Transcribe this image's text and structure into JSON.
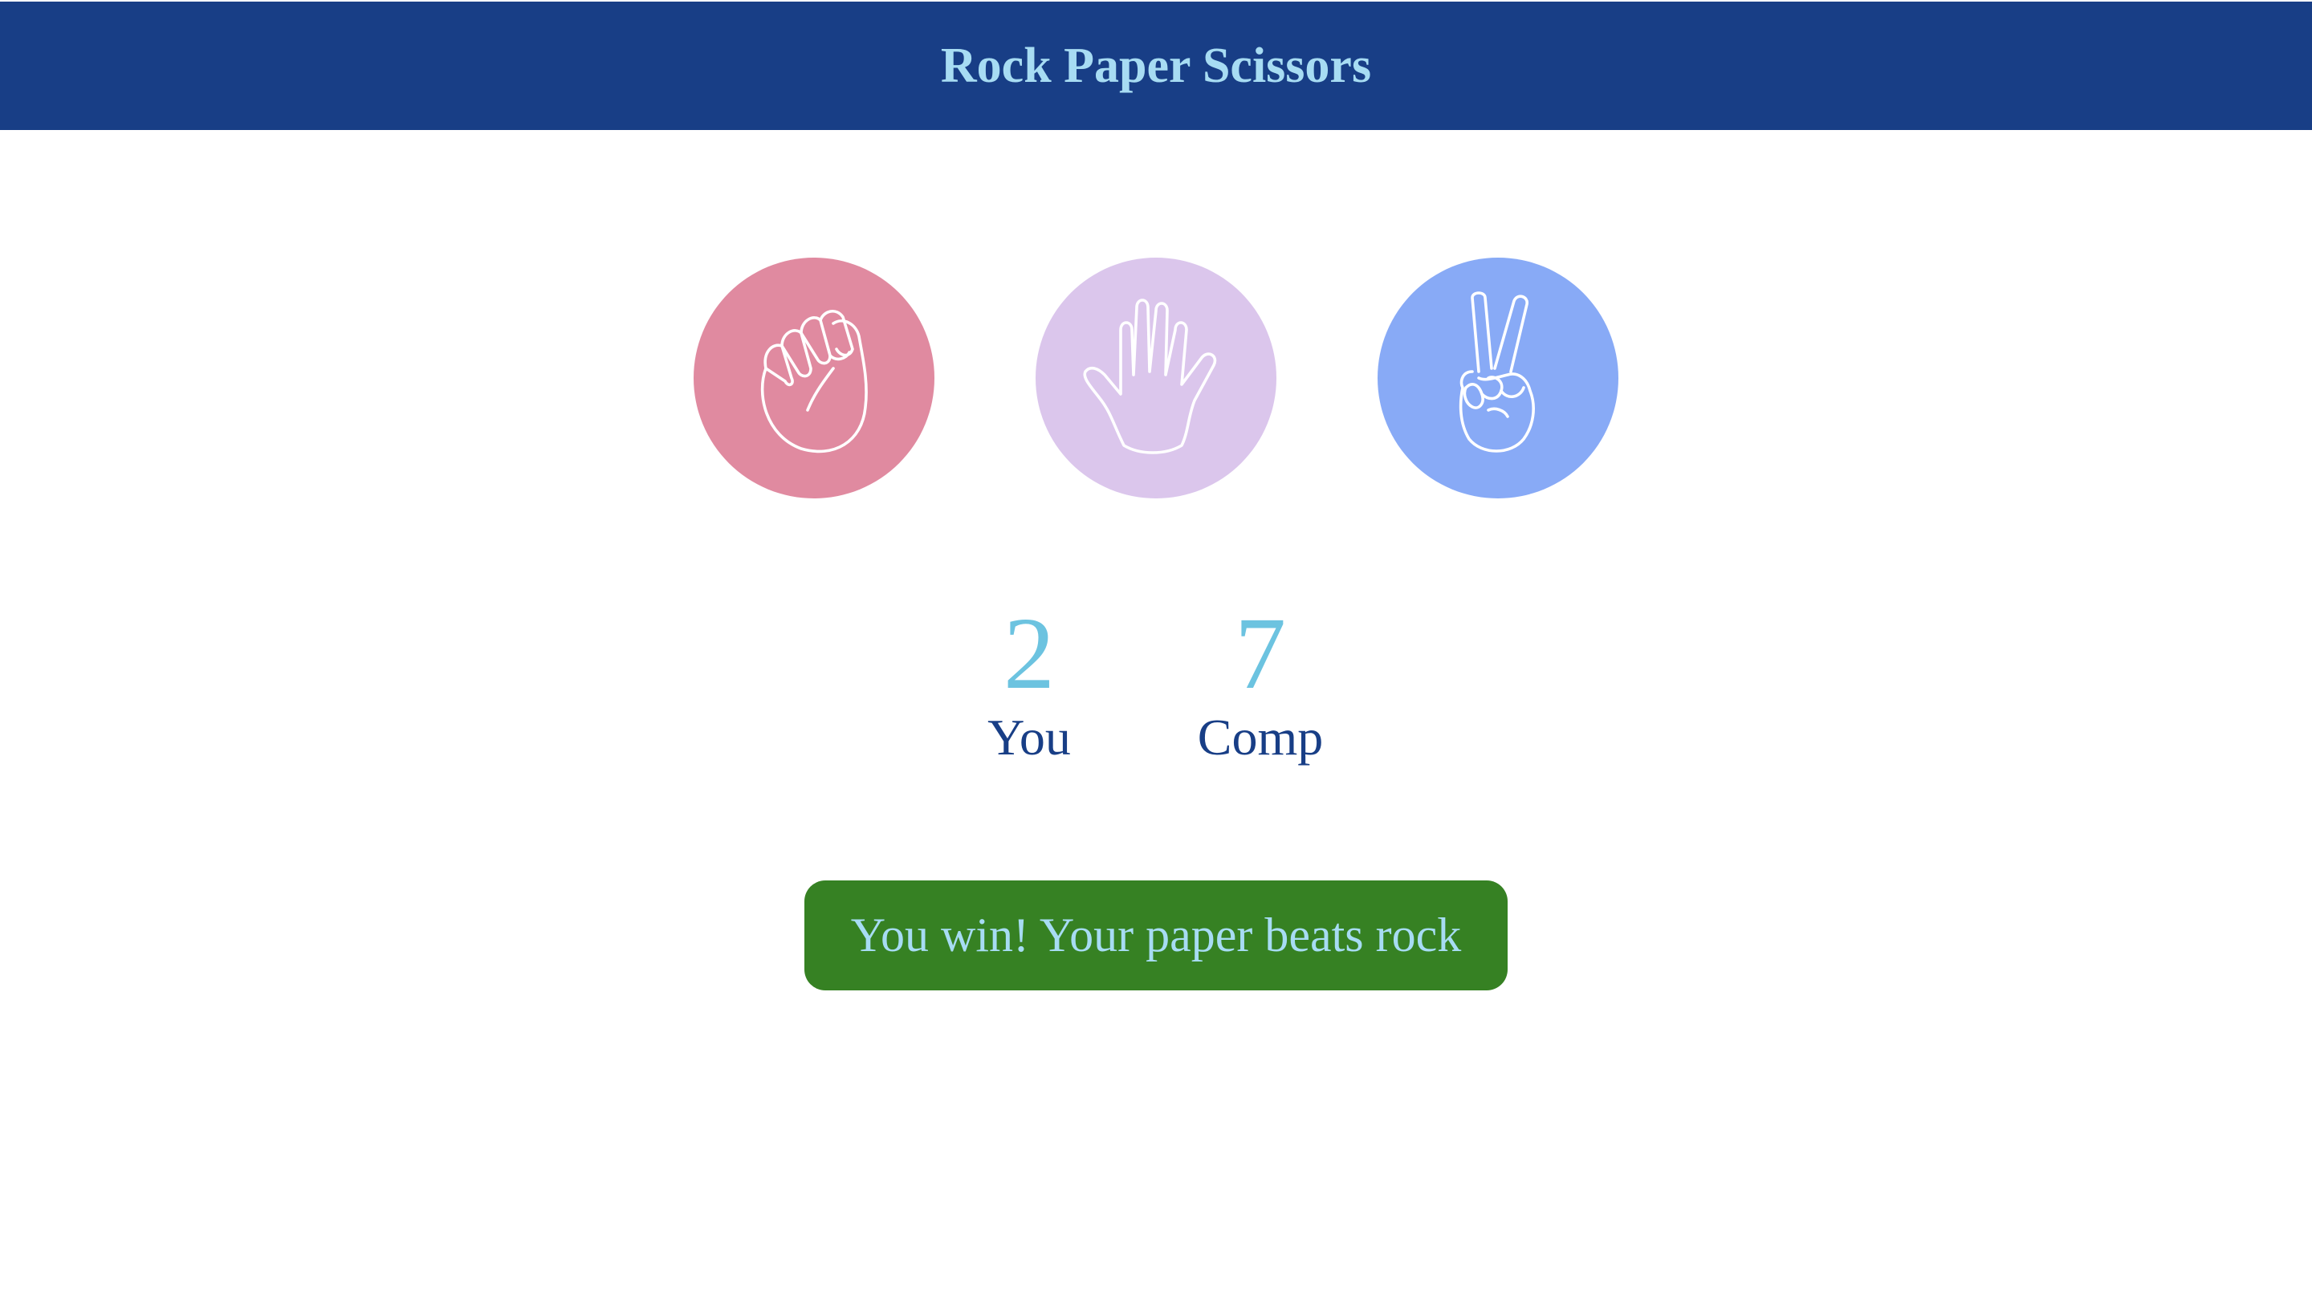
{
  "app": {
    "title": "Rock Paper Scissors"
  },
  "colors": {
    "header_bg": "#183e86",
    "title": "#a7dcf3",
    "rock": "#e08aa0",
    "paper": "#dbc6ec",
    "scissors": "#88aaf6",
    "score_number": "#6cc3e0",
    "score_label": "#183e86",
    "result_bg": "#368123",
    "result_text": "#a7dcf3"
  },
  "choices": [
    {
      "id": "rock",
      "icon": "fist-icon"
    },
    {
      "id": "paper",
      "icon": "open-hand-icon"
    },
    {
      "id": "scissors",
      "icon": "peace-sign-icon"
    }
  ],
  "scoreboard": {
    "user": {
      "score": "2",
      "label": "You"
    },
    "computer": {
      "score": "7",
      "label": "Comp"
    }
  },
  "result": {
    "message": "You win! Your paper beats rock"
  }
}
